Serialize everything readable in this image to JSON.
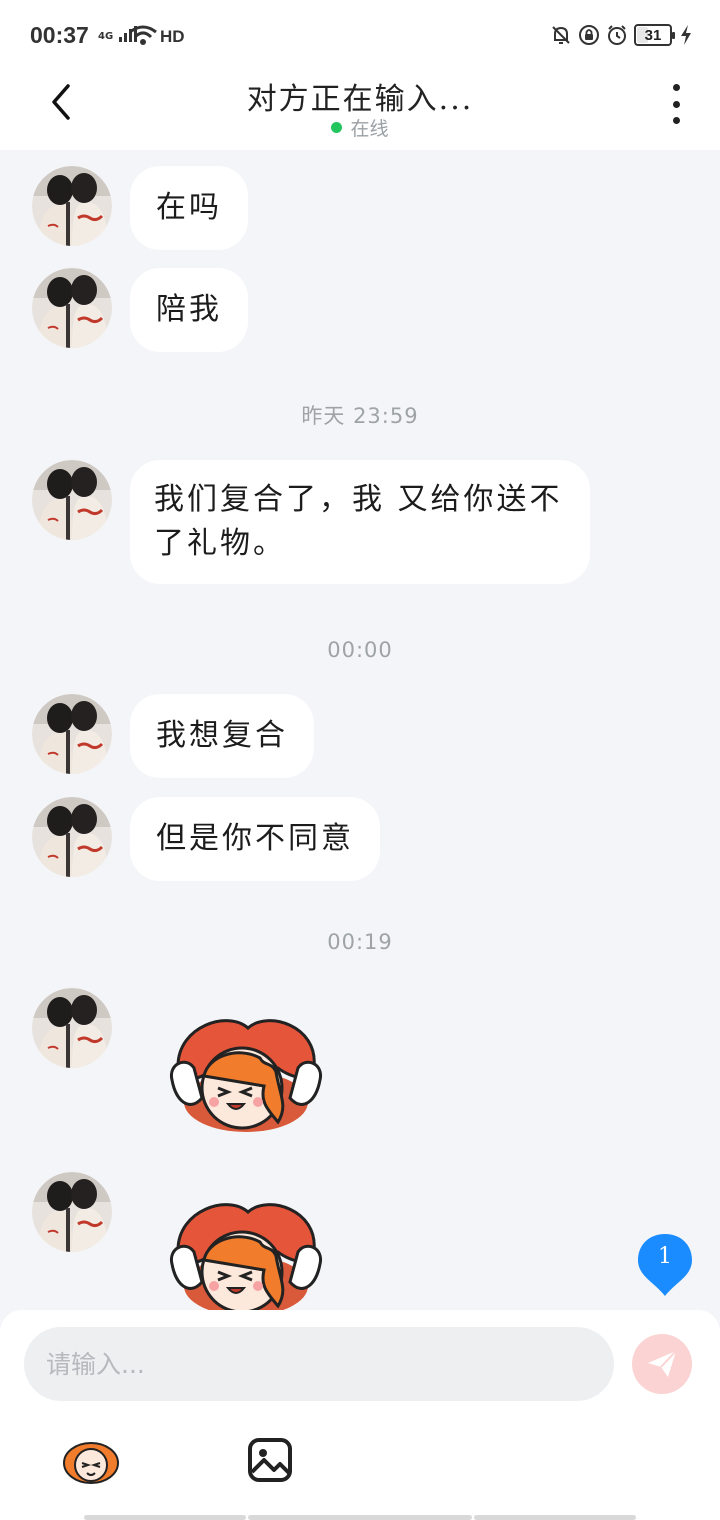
{
  "status_bar": {
    "time": "00:37",
    "network_tag": "4G",
    "hd_label": "HD",
    "battery_level": "31",
    "icons": [
      "signal-icon",
      "wifi-icon",
      "mute-icon",
      "dnd-icon",
      "alarm-icon",
      "battery-icon",
      "charging-icon"
    ]
  },
  "header": {
    "title": "对方正在输入...",
    "presence": "在线",
    "presence_color": "#22c55e"
  },
  "messages": [
    {
      "type": "text",
      "text": "在吗"
    },
    {
      "type": "text",
      "text": "陪我"
    },
    {
      "type": "time",
      "text": "昨天 23:59"
    },
    {
      "type": "text",
      "text": "我们复合了，我 又给你送不了礼物。"
    },
    {
      "type": "time",
      "text": "00:00"
    },
    {
      "type": "text",
      "text": "我想复合"
    },
    {
      "type": "text",
      "text": "但是你不同意"
    },
    {
      "type": "time",
      "text": "00:19"
    },
    {
      "type": "sticker",
      "icon": "cheer-sticker-icon"
    },
    {
      "type": "sticker",
      "icon": "cheer-sticker-icon"
    }
  ],
  "unread_badge": "1",
  "composer": {
    "placeholder": "请输入...",
    "send_color": "#fbd3d3",
    "tools": [
      "emoji-sticker-icon",
      "image-icon"
    ]
  },
  "colors": {
    "background": "#f4f5f8",
    "bubble": "#ffffff",
    "badge": "#1a8cff"
  }
}
